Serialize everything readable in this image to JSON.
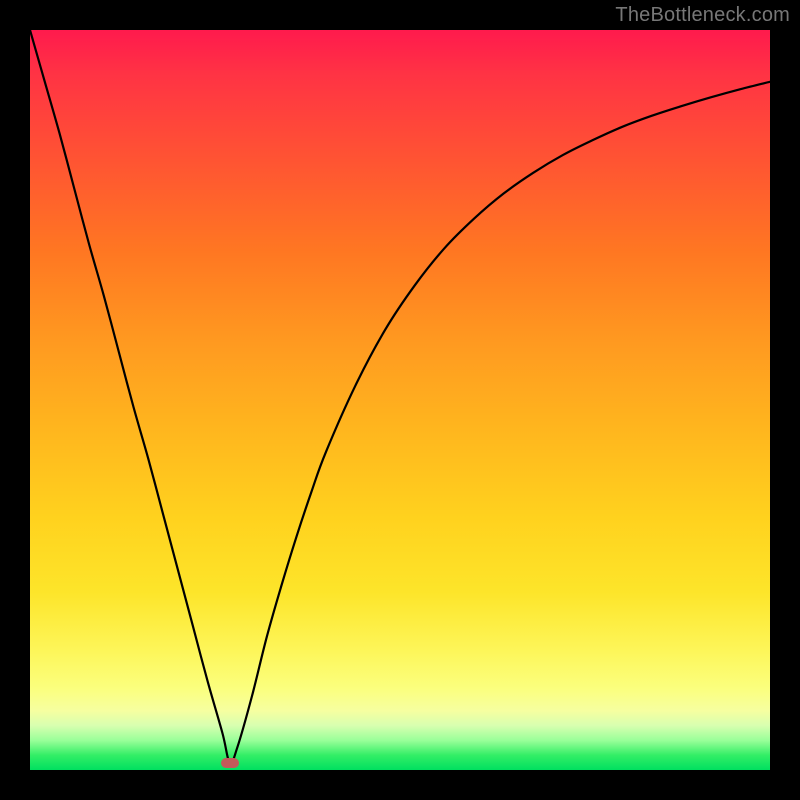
{
  "watermark": "TheBottleneck.com",
  "colors": {
    "frame": "#000000",
    "curve": "#000000",
    "marker": "#c35a5a",
    "gradient_top": "#ff1a4d",
    "gradient_bottom": "#00e060"
  },
  "chart_data": {
    "type": "line",
    "title": "",
    "xlabel": "",
    "ylabel": "",
    "xlim": [
      0,
      100
    ],
    "ylim": [
      0,
      100
    ],
    "grid": false,
    "legend": null,
    "x": [
      0,
      2,
      4,
      6,
      8,
      10,
      12,
      14,
      16,
      18,
      20,
      22,
      24,
      26,
      27,
      28,
      30,
      32,
      34,
      36,
      38,
      40,
      44,
      48,
      52,
      56,
      60,
      64,
      68,
      72,
      76,
      80,
      84,
      88,
      92,
      96,
      100
    ],
    "values": [
      100,
      93,
      86,
      78.5,
      71,
      64,
      56.5,
      49,
      42,
      34.5,
      27,
      19.5,
      12,
      5,
      1,
      3,
      10,
      18,
      25,
      31.5,
      37.5,
      43,
      52,
      59.5,
      65.5,
      70.5,
      74.5,
      77.9,
      80.7,
      83.1,
      85.1,
      86.9,
      88.4,
      89.7,
      90.9,
      92,
      93
    ],
    "marker": {
      "x": 27,
      "y": 1
    },
    "annotations": []
  }
}
